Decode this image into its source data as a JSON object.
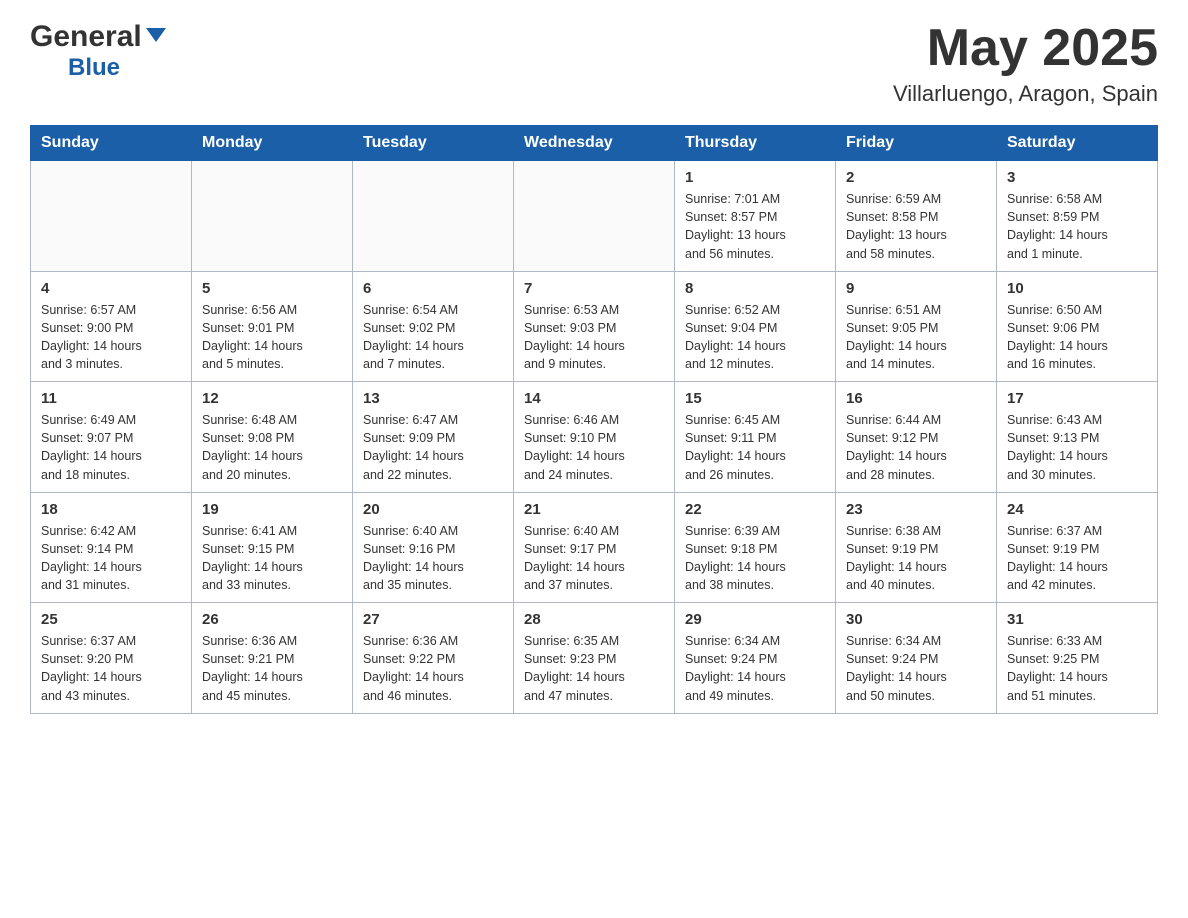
{
  "header": {
    "logo_general": "General",
    "logo_blue": "Blue",
    "month_year": "May 2025",
    "location": "Villarluengo, Aragon, Spain"
  },
  "days_of_week": [
    "Sunday",
    "Monday",
    "Tuesday",
    "Wednesday",
    "Thursday",
    "Friday",
    "Saturday"
  ],
  "weeks": [
    [
      {
        "day": "",
        "info": ""
      },
      {
        "day": "",
        "info": ""
      },
      {
        "day": "",
        "info": ""
      },
      {
        "day": "",
        "info": ""
      },
      {
        "day": "1",
        "info": "Sunrise: 7:01 AM\nSunset: 8:57 PM\nDaylight: 13 hours\nand 56 minutes."
      },
      {
        "day": "2",
        "info": "Sunrise: 6:59 AM\nSunset: 8:58 PM\nDaylight: 13 hours\nand 58 minutes."
      },
      {
        "day": "3",
        "info": "Sunrise: 6:58 AM\nSunset: 8:59 PM\nDaylight: 14 hours\nand 1 minute."
      }
    ],
    [
      {
        "day": "4",
        "info": "Sunrise: 6:57 AM\nSunset: 9:00 PM\nDaylight: 14 hours\nand 3 minutes."
      },
      {
        "day": "5",
        "info": "Sunrise: 6:56 AM\nSunset: 9:01 PM\nDaylight: 14 hours\nand 5 minutes."
      },
      {
        "day": "6",
        "info": "Sunrise: 6:54 AM\nSunset: 9:02 PM\nDaylight: 14 hours\nand 7 minutes."
      },
      {
        "day": "7",
        "info": "Sunrise: 6:53 AM\nSunset: 9:03 PM\nDaylight: 14 hours\nand 9 minutes."
      },
      {
        "day": "8",
        "info": "Sunrise: 6:52 AM\nSunset: 9:04 PM\nDaylight: 14 hours\nand 12 minutes."
      },
      {
        "day": "9",
        "info": "Sunrise: 6:51 AM\nSunset: 9:05 PM\nDaylight: 14 hours\nand 14 minutes."
      },
      {
        "day": "10",
        "info": "Sunrise: 6:50 AM\nSunset: 9:06 PM\nDaylight: 14 hours\nand 16 minutes."
      }
    ],
    [
      {
        "day": "11",
        "info": "Sunrise: 6:49 AM\nSunset: 9:07 PM\nDaylight: 14 hours\nand 18 minutes."
      },
      {
        "day": "12",
        "info": "Sunrise: 6:48 AM\nSunset: 9:08 PM\nDaylight: 14 hours\nand 20 minutes."
      },
      {
        "day": "13",
        "info": "Sunrise: 6:47 AM\nSunset: 9:09 PM\nDaylight: 14 hours\nand 22 minutes."
      },
      {
        "day": "14",
        "info": "Sunrise: 6:46 AM\nSunset: 9:10 PM\nDaylight: 14 hours\nand 24 minutes."
      },
      {
        "day": "15",
        "info": "Sunrise: 6:45 AM\nSunset: 9:11 PM\nDaylight: 14 hours\nand 26 minutes."
      },
      {
        "day": "16",
        "info": "Sunrise: 6:44 AM\nSunset: 9:12 PM\nDaylight: 14 hours\nand 28 minutes."
      },
      {
        "day": "17",
        "info": "Sunrise: 6:43 AM\nSunset: 9:13 PM\nDaylight: 14 hours\nand 30 minutes."
      }
    ],
    [
      {
        "day": "18",
        "info": "Sunrise: 6:42 AM\nSunset: 9:14 PM\nDaylight: 14 hours\nand 31 minutes."
      },
      {
        "day": "19",
        "info": "Sunrise: 6:41 AM\nSunset: 9:15 PM\nDaylight: 14 hours\nand 33 minutes."
      },
      {
        "day": "20",
        "info": "Sunrise: 6:40 AM\nSunset: 9:16 PM\nDaylight: 14 hours\nand 35 minutes."
      },
      {
        "day": "21",
        "info": "Sunrise: 6:40 AM\nSunset: 9:17 PM\nDaylight: 14 hours\nand 37 minutes."
      },
      {
        "day": "22",
        "info": "Sunrise: 6:39 AM\nSunset: 9:18 PM\nDaylight: 14 hours\nand 38 minutes."
      },
      {
        "day": "23",
        "info": "Sunrise: 6:38 AM\nSunset: 9:19 PM\nDaylight: 14 hours\nand 40 minutes."
      },
      {
        "day": "24",
        "info": "Sunrise: 6:37 AM\nSunset: 9:19 PM\nDaylight: 14 hours\nand 42 minutes."
      }
    ],
    [
      {
        "day": "25",
        "info": "Sunrise: 6:37 AM\nSunset: 9:20 PM\nDaylight: 14 hours\nand 43 minutes."
      },
      {
        "day": "26",
        "info": "Sunrise: 6:36 AM\nSunset: 9:21 PM\nDaylight: 14 hours\nand 45 minutes."
      },
      {
        "day": "27",
        "info": "Sunrise: 6:36 AM\nSunset: 9:22 PM\nDaylight: 14 hours\nand 46 minutes."
      },
      {
        "day": "28",
        "info": "Sunrise: 6:35 AM\nSunset: 9:23 PM\nDaylight: 14 hours\nand 47 minutes."
      },
      {
        "day": "29",
        "info": "Sunrise: 6:34 AM\nSunset: 9:24 PM\nDaylight: 14 hours\nand 49 minutes."
      },
      {
        "day": "30",
        "info": "Sunrise: 6:34 AM\nSunset: 9:24 PM\nDaylight: 14 hours\nand 50 minutes."
      },
      {
        "day": "31",
        "info": "Sunrise: 6:33 AM\nSunset: 9:25 PM\nDaylight: 14 hours\nand 51 minutes."
      }
    ]
  ]
}
